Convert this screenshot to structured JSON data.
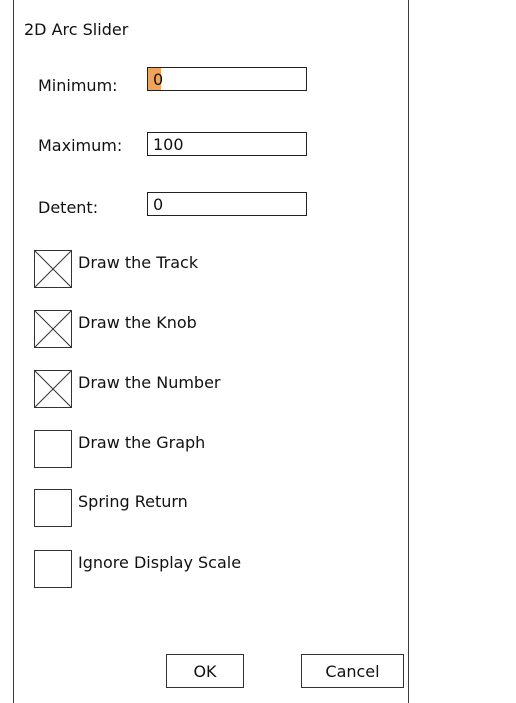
{
  "dialog": {
    "title": "2D Arc Slider"
  },
  "fields": {
    "minimum": {
      "label": "Minimum:",
      "value": "0"
    },
    "maximum": {
      "label": "Maximum:",
      "value": "100"
    },
    "detent": {
      "label": "Detent:",
      "value": "0"
    }
  },
  "options": [
    {
      "label": "Draw the Track",
      "checked": true
    },
    {
      "label": "Draw the Knob",
      "checked": true
    },
    {
      "label": "Draw the Number",
      "checked": true
    },
    {
      "label": "Draw the Graph",
      "checked": false
    },
    {
      "label": "Spring Return",
      "checked": false
    },
    {
      "label": "Ignore Display Scale",
      "checked": false
    }
  ],
  "buttons": {
    "ok_label": "OK",
    "cancel_label": "Cancel"
  }
}
